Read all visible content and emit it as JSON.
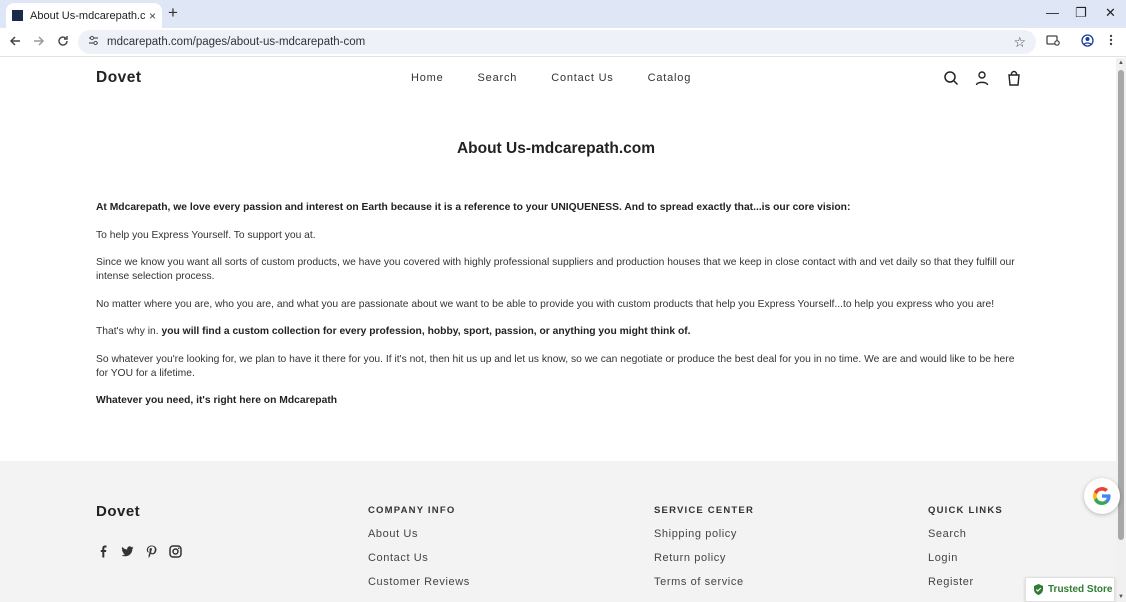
{
  "browser": {
    "tab_title": "About Us-mdcarepath.com - D",
    "tab_close": "×",
    "new_tab": "+",
    "url": "mdcarepath.com/pages/about-us-mdcarepath-com",
    "window_controls": {
      "minimize": "—",
      "restore": "❐",
      "close": "✕"
    }
  },
  "header": {
    "brand": "Dovet",
    "nav": [
      "Home",
      "Search",
      "Contact Us",
      "Catalog"
    ]
  },
  "content": {
    "title": "About Us-mdcarepath.com",
    "p1": "At Mdcarepath, we love every passion and interest on Earth because it is a reference to your UNIQUENESS. And to spread exactly that...is our core vision:",
    "p2": "To help you Express Yourself. To support you at.",
    "p3": "Since we know you want all sorts of custom products, we have you covered with highly professional suppliers and production houses that we keep in close contact with and vet daily so that they fulfill our intense selection process.",
    "p4": "No matter where you are, who you are, and what you are passionate about we want to be able to provide you with custom products that help you Express Yourself...to help you express who you are!",
    "p5_lead": "That's why in.",
    "p5_strong": "you will find a custom collection for every profession, hobby, sport, passion, or anything you might think of.",
    "p6": "So whatever you're looking for, we plan to have it there for you. If it's not, then hit us up and let us know, so we can negotiate or produce the best deal for you in no time. We are and would like to be here for YOU for a lifetime.",
    "p7": "Whatever you need, it's right here on Mdcarepath"
  },
  "footer": {
    "brand": "Dovet",
    "company_info": {
      "heading": "COMPANY INFO",
      "links": [
        "About Us",
        "Contact Us",
        "Customer Reviews"
      ]
    },
    "service_center": {
      "heading": "SERVICE CENTER",
      "links": [
        "Shipping policy",
        "Return policy",
        "Terms of service"
      ]
    },
    "quick_links": {
      "heading": "QUICK LINKS",
      "links": [
        "Search",
        "Login",
        "Register"
      ]
    },
    "socials": [
      "facebook-icon",
      "twitter-icon",
      "pinterest-icon",
      "instagram-icon"
    ]
  },
  "badges": {
    "trusted_store": "Trusted Store"
  },
  "colors": {
    "tabbar": "#dfe7f7",
    "footer_bg": "#f3f3f3",
    "trusted_green": "#2e7d32"
  }
}
